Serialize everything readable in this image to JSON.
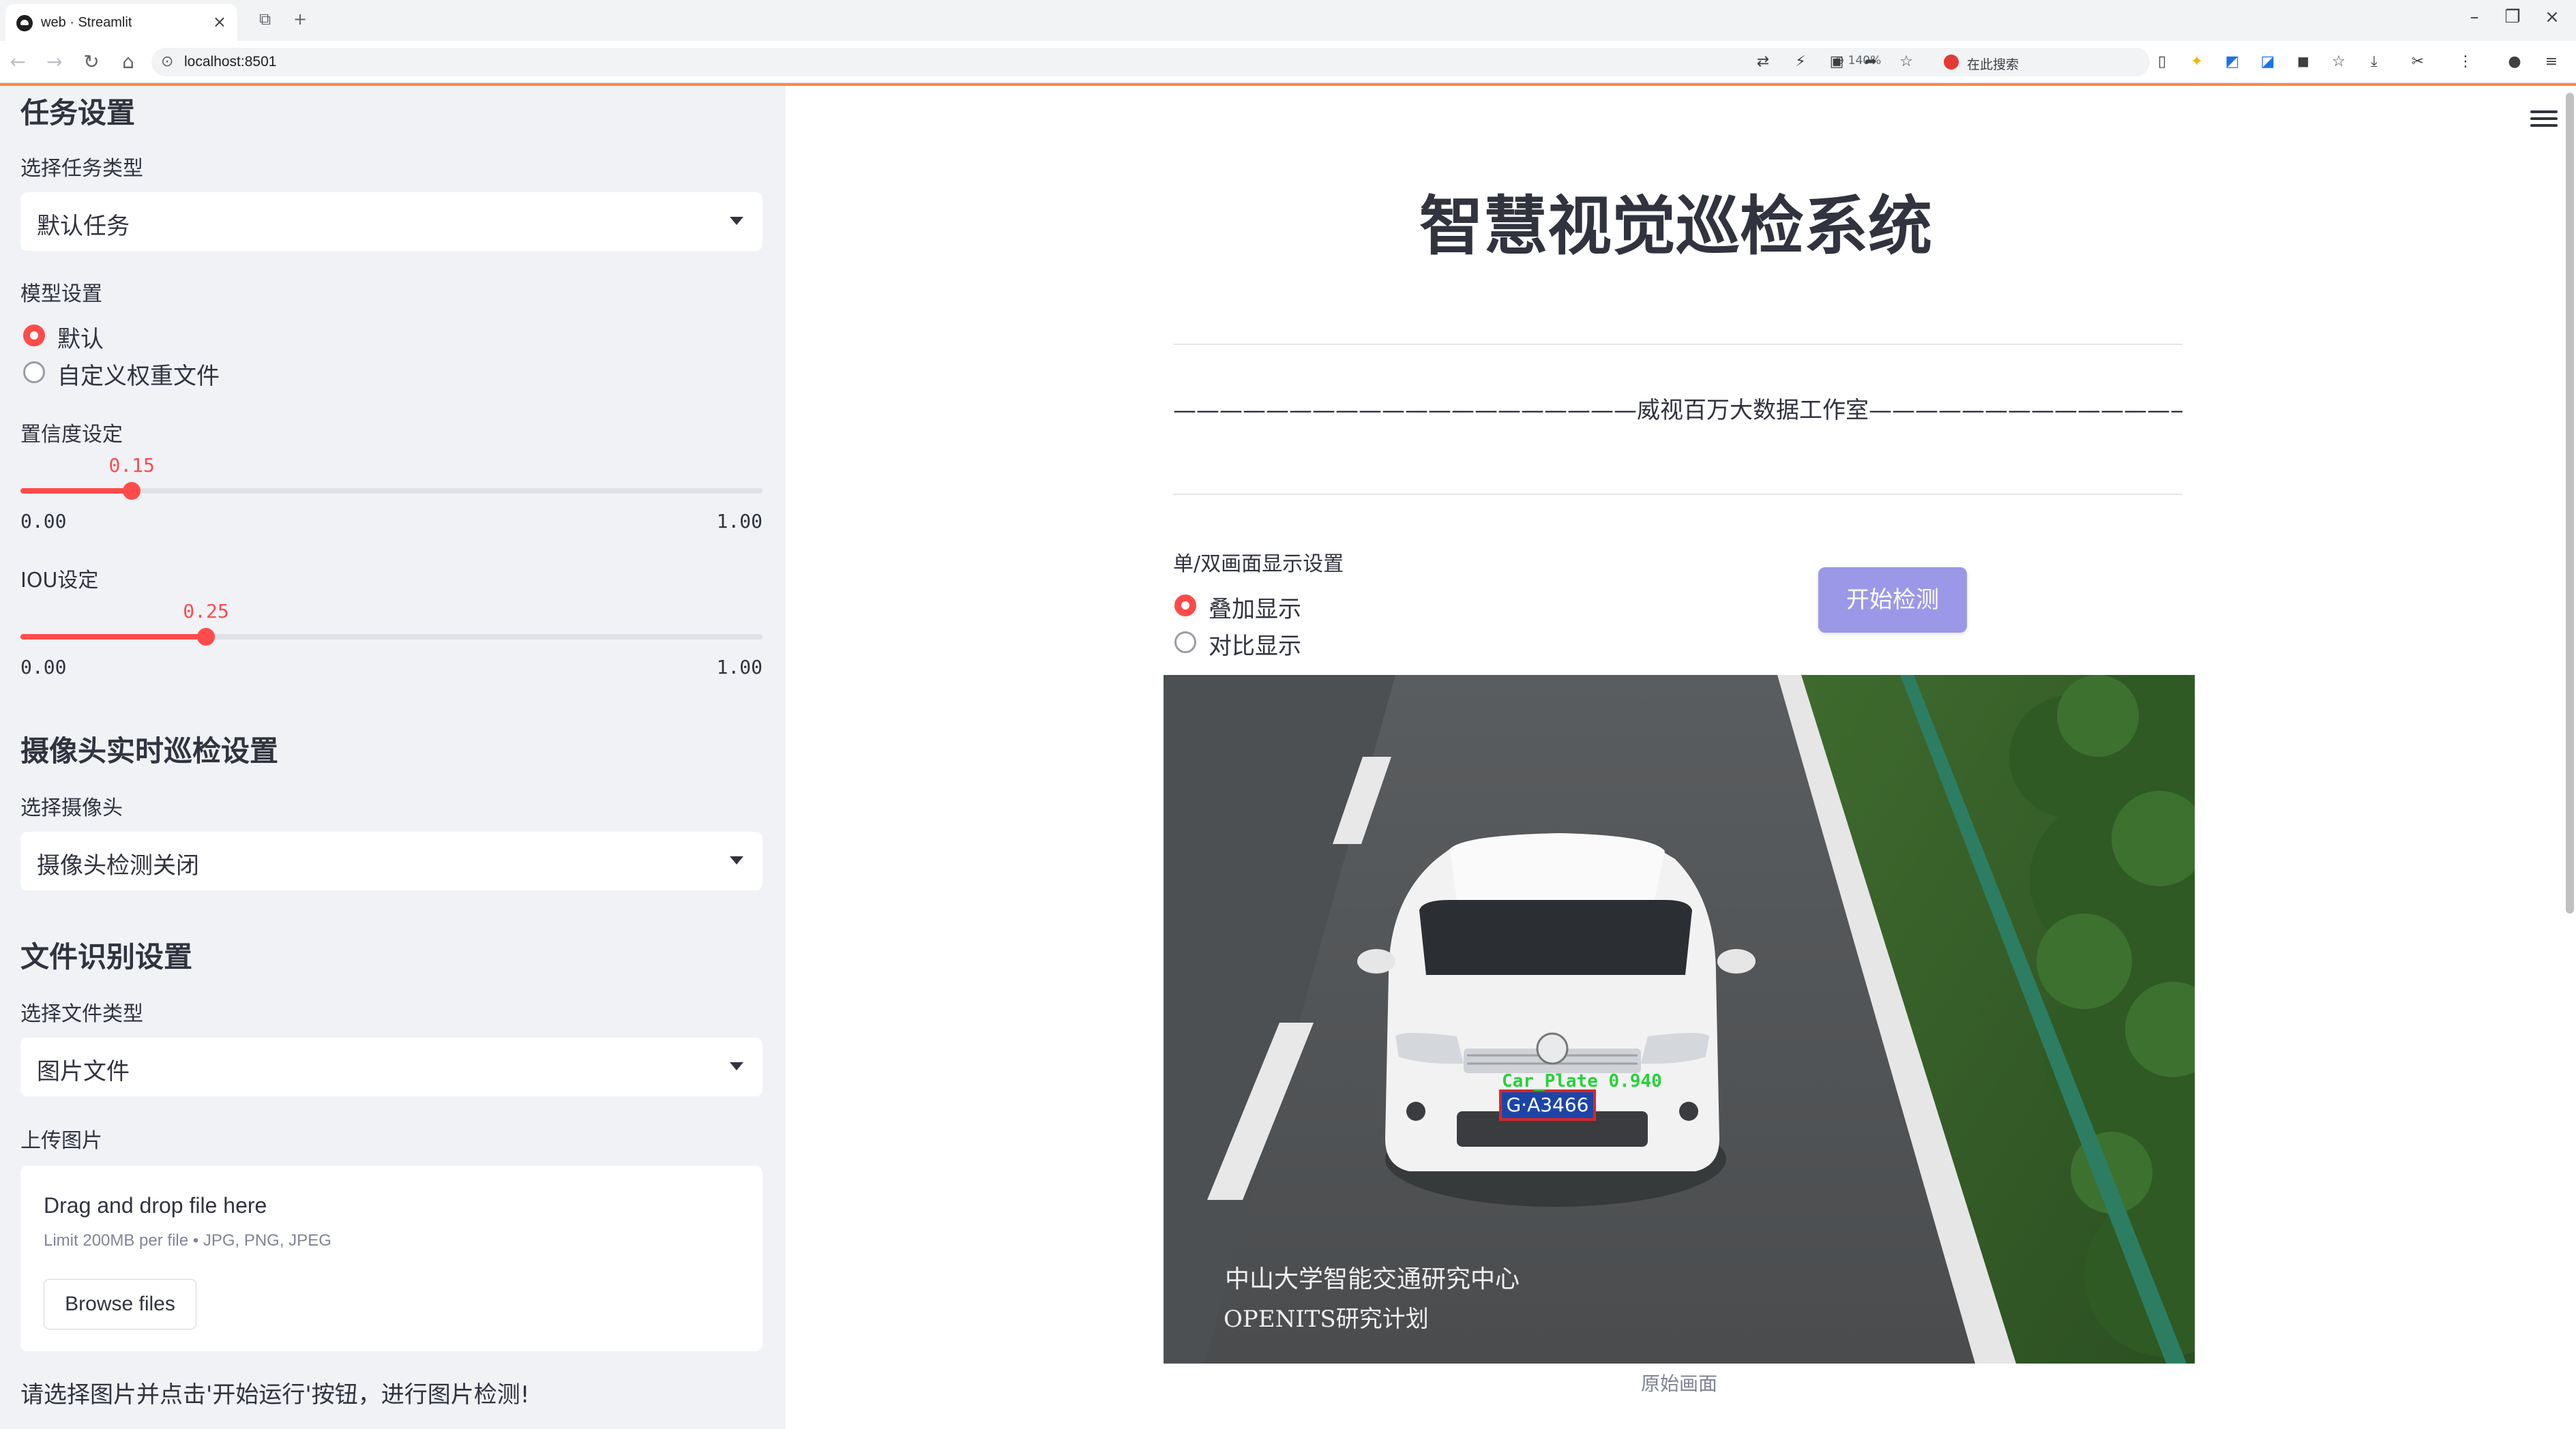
{
  "browser": {
    "tab_title": "web · Streamlit",
    "url": "localhost:8501",
    "zoom": "140%",
    "search_placeholder": "在此搜索"
  },
  "sidebar": {
    "task_header": "任务设置",
    "task_type_label": "选择任务类型",
    "task_type_value": "默认任务",
    "model_label": "模型设置",
    "model_options": [
      "默认",
      "自定义权重文件"
    ],
    "model_selected": "默认",
    "confidence": {
      "label": "置信度设定",
      "value": 0.15,
      "value_text": "0.15",
      "min": "0.00",
      "max": "1.00"
    },
    "iou": {
      "label": "IOU设定",
      "value": 0.25,
      "value_text": "0.25",
      "min": "0.00",
      "max": "1.00"
    },
    "camera_header": "摄像头实时巡检设置",
    "camera_label": "选择摄像头",
    "camera_value": "摄像头检测关闭",
    "file_header": "文件识别设置",
    "file_type_label": "选择文件类型",
    "file_type_value": "图片文件",
    "upload_label": "上传图片",
    "upload_title": "Drag and drop file here",
    "upload_limit": "Limit 200MB per file • JPG, PNG, JPEG",
    "browse_button": "Browse files",
    "hint": "请选择图片并点击'开始运行'按钮，进行图片检测!"
  },
  "main": {
    "title": "智慧视觉巡检系统",
    "subtitle": "————————————————————威视百万大数据工作室—————————————————————",
    "display_label": "单/双画面显示设置",
    "display_options": [
      "叠加显示",
      "对比显示"
    ],
    "display_selected": "叠加显示",
    "start_button": "开始检测",
    "image": {
      "detection_label": "Car_Plate 0.940",
      "plate_text": "G·A3466",
      "watermark_line1": "中山大学智能交通研究中心",
      "watermark_line2": "OPENITS研究计划"
    },
    "caption": "原始画面"
  },
  "colors": {
    "accent": "#ff4b4b",
    "button": "#9c98e8",
    "sidebar_bg": "#f0f2f6",
    "detection_box": "#1a9c2a"
  }
}
